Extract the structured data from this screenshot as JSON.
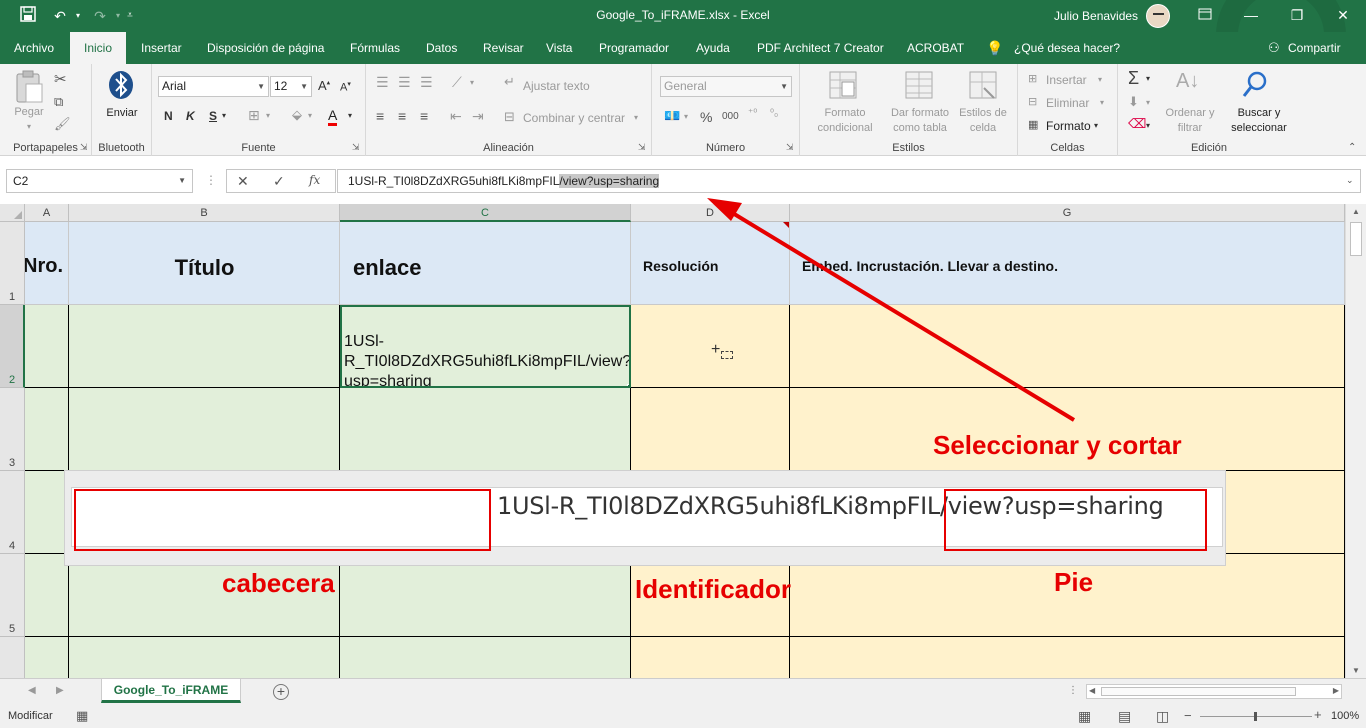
{
  "window": {
    "title": "Google_To_iFRAME.xlsx  -  Excel",
    "user": "Julio Benavides"
  },
  "quick_access": {
    "icons": [
      "save-icon",
      "undo-icon",
      "redo-icon",
      "customize-icon"
    ]
  },
  "tabs": [
    "Archivo",
    "Inicio",
    "Insertar",
    "Disposición de página",
    "Fórmulas",
    "Datos",
    "Revisar",
    "Vista",
    "Programador",
    "Ayuda",
    "PDF Architect 7 Creator",
    "ACROBAT"
  ],
  "active_tab": "Inicio",
  "tell_me": "¿Qué desea hacer?",
  "share": "Compartir",
  "ribbon": {
    "clipboard": {
      "paste": "Pegar",
      "label": "Portapapeles"
    },
    "bluetooth": {
      "send": "Enviar",
      "label": "Bluetooth"
    },
    "font": {
      "name": "Arial",
      "size": "12",
      "bold": "N",
      "italic": "K",
      "underline": "S",
      "label": "Fuente"
    },
    "alignment": {
      "wrap": "Ajustar texto",
      "merge": "Combinar y centrar",
      "label": "Alineación"
    },
    "number": {
      "format": "General",
      "percent": "%",
      "thousands": "000",
      "label": "Número"
    },
    "styles": {
      "conditional": "Formato condicional",
      "table": "Dar formato como tabla",
      "cell": "Estilos de celda",
      "label": "Estilos"
    },
    "cells": {
      "insert": "Insertar",
      "delete": "Eliminar",
      "format": "Formato",
      "label": "Celdas"
    },
    "editing": {
      "sort": "Ordenar y filtrar",
      "find": "Buscar y seleccionar",
      "label": "Edición"
    }
  },
  "formula_bar": {
    "name_box": "C2",
    "fx": "fx",
    "content_id": "1USl-R_TI0l8DZdXRG5uhi8fLKi8mpFIL",
    "content_selected": "/view?usp=sharing"
  },
  "grid": {
    "columns": [
      "A",
      "B",
      "C",
      "D",
      "G"
    ],
    "rows": [
      "1",
      "2",
      "3",
      "4",
      "5"
    ],
    "headers": {
      "a": "Nro.",
      "b": "Título",
      "c": "enlace",
      "d": "Resolución",
      "g": "Embed. Incrustación. Llevar a destino."
    },
    "cell_c2": [
      "1USl-",
      "R_TI0l8DZdXRG5uhi8fLKi8mpFIL/view?",
      "usp=sharing"
    ]
  },
  "sheet": {
    "tab": "Google_To_iFRAME"
  },
  "status": {
    "mode": "Modificar",
    "zoom": "100%"
  },
  "annotations": {
    "zoom_text": "1USl-R_TI0l8DZdXRG5uhi8fLKi8mpFIL/view?usp=sharing",
    "cut_label": "Seleccionar y cortar",
    "header_label": "cabecera",
    "id_label": "Identificador",
    "footer_label": "Pie"
  },
  "colors": {
    "excel_green": "#217346",
    "header_fill": "#dce8f5",
    "green_fill": "#e2efda",
    "yellow_fill": "#fff2cc",
    "annotation_red": "#e60000"
  }
}
